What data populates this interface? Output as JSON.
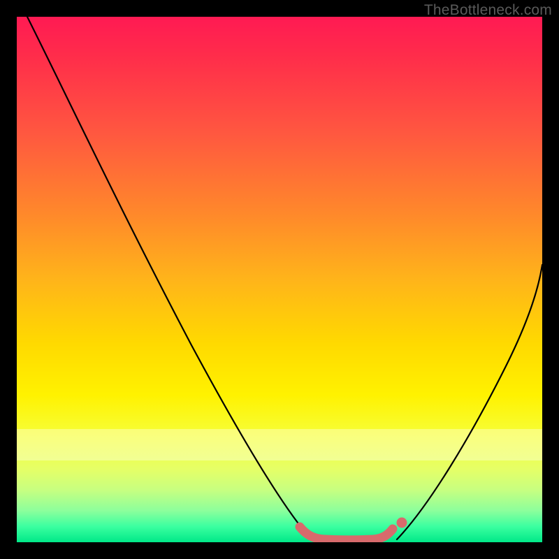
{
  "watermark": "TheBottleneck.com",
  "chart_data": {
    "type": "line",
    "title": "",
    "xlabel": "",
    "ylabel": "",
    "xlim": [
      0,
      100
    ],
    "ylim": [
      0,
      100
    ],
    "grid": false,
    "legend": false,
    "background_gradient": {
      "stops": [
        {
          "pos": 0,
          "color": "#ff1a53",
          "meaning": "high-bottleneck"
        },
        {
          "pos": 50,
          "color": "#ffd900"
        },
        {
          "pos": 80,
          "color": "#f6ff3a"
        },
        {
          "pos": 100,
          "color": "#00e888",
          "meaning": "low-bottleneck"
        }
      ]
    },
    "series": [
      {
        "name": "left-curve",
        "color": "#000000",
        "x": [
          2,
          10,
          20,
          30,
          40,
          48,
          53,
          56
        ],
        "y": [
          100,
          83,
          62,
          42,
          23,
          8,
          2,
          0
        ]
      },
      {
        "name": "right-curve",
        "color": "#000000",
        "x": [
          72,
          76,
          82,
          88,
          94,
          100
        ],
        "y": [
          0,
          5,
          15,
          27,
          40,
          53
        ]
      },
      {
        "name": "optimal-zone-marker",
        "color": "#d86a6c",
        "style": "thick-rounded",
        "x": [
          54,
          56,
          58,
          60,
          62,
          64,
          66,
          68,
          70,
          71.5
        ],
        "y": [
          1.6,
          0.6,
          0.3,
          0.2,
          0.2,
          0.2,
          0.2,
          0.3,
          0.6,
          1.6
        ]
      },
      {
        "name": "optimal-zone-end-dot",
        "color": "#d86a6c",
        "style": "dot",
        "x": [
          73.2
        ],
        "y": [
          3.0
        ]
      }
    ]
  }
}
